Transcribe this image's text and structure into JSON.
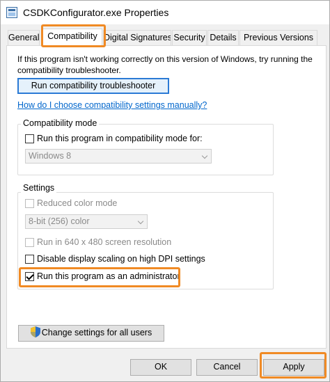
{
  "window": {
    "title": "CSDKConfigurator.exe Properties",
    "icon": "app-icon"
  },
  "tabs": [
    {
      "label": "General",
      "active": false
    },
    {
      "label": "Compatibility",
      "active": true
    },
    {
      "label": "Digital Signatures",
      "active": false
    },
    {
      "label": "Security",
      "active": false
    },
    {
      "label": "Details",
      "active": false
    },
    {
      "label": "Previous Versions",
      "active": false
    }
  ],
  "compatibility": {
    "intro": "If this program isn't working correctly on this version of Windows, try running the compatibility troubleshooter.",
    "troubleshooter_button": "Run compatibility troubleshooter",
    "help_link": "How do I choose compatibility settings manually?",
    "mode_group": {
      "label": "Compatibility mode",
      "checkbox_label": "Run this program in compatibility mode for:",
      "checked": false,
      "selected_os": "Windows 8"
    },
    "settings_group": {
      "label": "Settings",
      "reduced_color_label": "Reduced color mode",
      "reduced_color_checked": false,
      "color_depth": "8-bit (256) color",
      "run_640_label": "Run in 640 x 480 screen resolution",
      "run_640_checked": false,
      "disable_dpi_label": "Disable display scaling on high DPI settings",
      "disable_dpi_checked": false,
      "run_admin_label": "Run this program as an administrator",
      "run_admin_checked": true
    },
    "change_all_button": "Change settings for all users"
  },
  "footer": {
    "ok": "OK",
    "cancel": "Cancel",
    "apply": "Apply"
  },
  "colors": {
    "highlight": "#f08a24",
    "link": "#0066cc",
    "focus": "#2a7ad5"
  }
}
